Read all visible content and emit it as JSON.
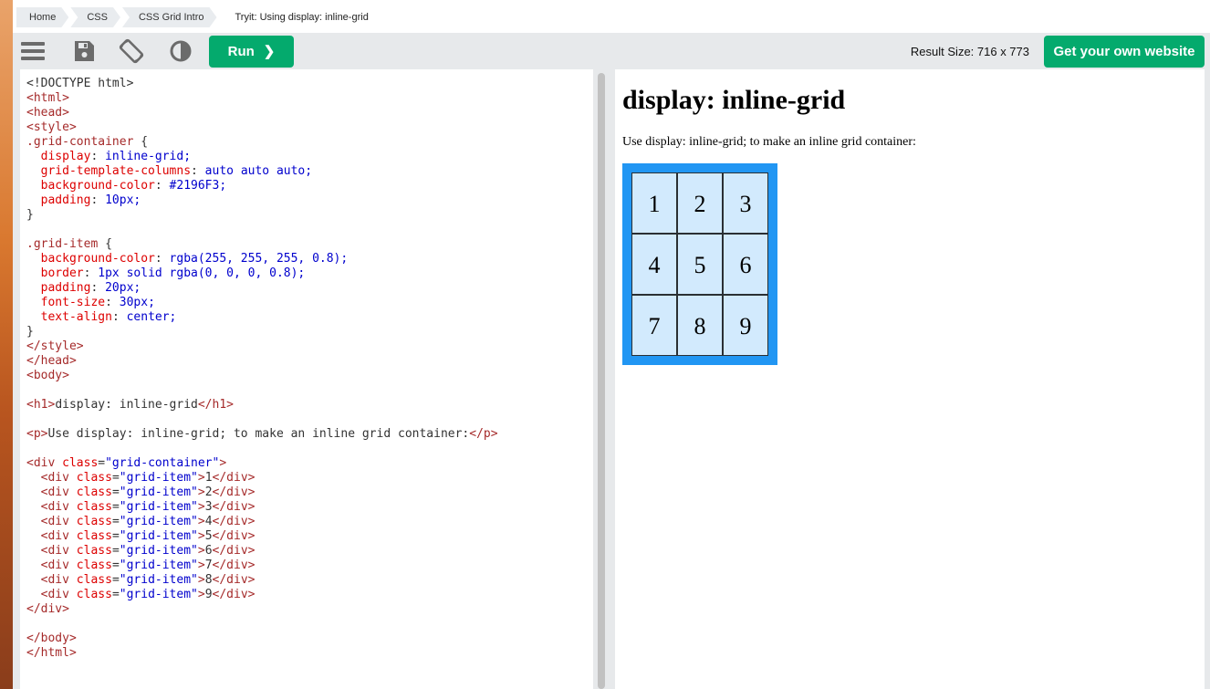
{
  "breadcrumb": [
    "Home",
    "CSS",
    "CSS Grid Intro",
    "Tryit: Using display: inline-grid"
  ],
  "toolbar": {
    "icons": [
      "menu-icon",
      "save-icon",
      "rotate-icon",
      "contrast-icon"
    ],
    "run_label": "Run",
    "run_chevron": "❯",
    "result_size": "Result Size: 716 x 773",
    "get_website_label": "Get your own website"
  },
  "code_lines": [
    "<!DOCTYPE html>",
    "<html>",
    "<head>",
    "<style>",
    ".grid-container {",
    "  display: inline-grid;",
    "  grid-template-columns: auto auto auto;",
    "  background-color: #2196F3;",
    "  padding: 10px;",
    "}",
    "",
    ".grid-item {",
    "  background-color: rgba(255, 255, 255, 0.8);",
    "  border: 1px solid rgba(0, 0, 0, 0.8);",
    "  padding: 20px;",
    "  font-size: 30px;",
    "  text-align: center;",
    "}",
    "</style>",
    "</head>",
    "<body>",
    "",
    "<h1>display: inline-grid</h1>",
    "",
    "<p>Use display: inline-grid; to make an inline grid container:</p>",
    "",
    "<div class=\"grid-container\">",
    "  <div class=\"grid-item\">1</div>",
    "  <div class=\"grid-item\">2</div>",
    "  <div class=\"grid-item\">3</div>",
    "  <div class=\"grid-item\">4</div>",
    "  <div class=\"grid-item\">5</div>",
    "  <div class=\"grid-item\">6</div>",
    "  <div class=\"grid-item\">7</div>",
    "  <div class=\"grid-item\">8</div>",
    "  <div class=\"grid-item\">9</div>",
    "</div>",
    "",
    "</body>",
    "</html>"
  ],
  "result": {
    "heading": "display: inline-grid",
    "paragraph": "Use display: inline-grid; to make an inline grid container:",
    "grid_items": [
      "1",
      "2",
      "3",
      "4",
      "5",
      "6",
      "7",
      "8",
      "9"
    ],
    "grid_background": "#2196F3"
  },
  "colors": {
    "accent_green": "#04aa6d",
    "toolbar_gray": "#e7e9eb"
  }
}
